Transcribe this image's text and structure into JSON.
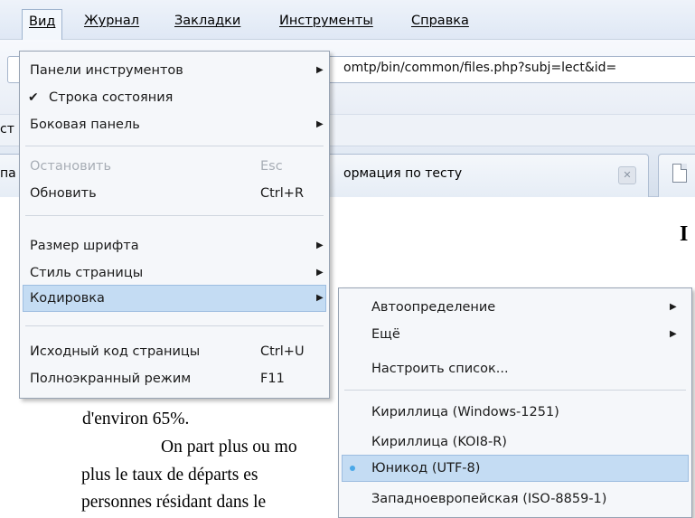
{
  "menubar": {
    "items": [
      "Вид",
      "Журнал",
      "Закладки",
      "Инструменты",
      "Справка"
    ]
  },
  "urlbar": {
    "value": "omtp/bin/common/files.php?subj=lect&id="
  },
  "bookmarks": {
    "stub": "ст"
  },
  "tabs": {
    "left_stub": "па",
    "active_label": "ормация по тесту"
  },
  "view_menu": {
    "items": [
      {
        "label": "Панели инструментов",
        "submenu": true
      },
      {
        "label": "Строка состояния",
        "checked": true
      },
      {
        "label": "Боковая панель",
        "submenu": true
      },
      {
        "label": "Остановить",
        "accel": "Esc",
        "disabled": true
      },
      {
        "label": "Обновить",
        "accel": "Ctrl+R"
      },
      {
        "label": "Размер шрифта",
        "submenu": true
      },
      {
        "label": "Стиль страницы",
        "submenu": true
      },
      {
        "label": "Кодировка",
        "submenu": true,
        "highlight": true
      },
      {
        "label": "Исходный код страницы",
        "accel": "Ctrl+U"
      },
      {
        "label": "Полноэкранный режим",
        "accel": "F11"
      }
    ]
  },
  "encoding_menu": {
    "items": [
      {
        "label": "Автоопределение",
        "submenu": true
      },
      {
        "label": "Ещё",
        "submenu": true
      },
      {
        "label": "Настроить список..."
      },
      {
        "label": "Кириллица (Windows-1251)"
      },
      {
        "label": "Кириллица (KOI8-R)"
      },
      {
        "label": "Юникод (UTF-8)",
        "selected": true,
        "highlight": true
      },
      {
        "label": "Западноевропейская (ISO-8859-1)"
      }
    ]
  },
  "page": {
    "heading_letter": "I",
    "lines": [
      "d'environ 65%.",
      "On part plus ou mo",
      "plus le taux de départs es",
      "personnes résidant dans le"
    ]
  },
  "colors": {
    "menu_bg": "#f5f7fa",
    "highlight": "#c4dcf3",
    "radio": "#4aa8e8"
  }
}
